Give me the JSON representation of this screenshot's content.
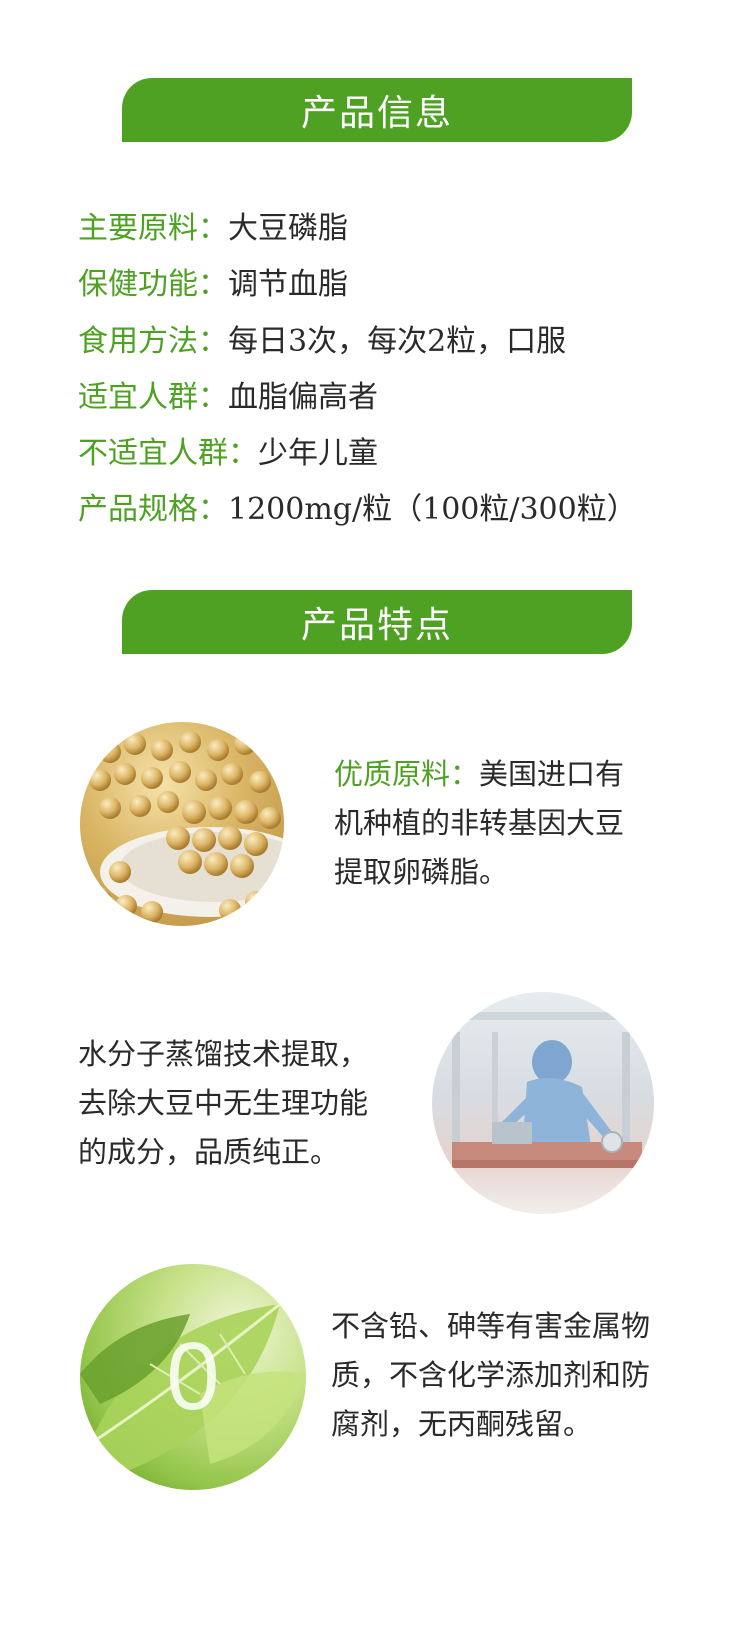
{
  "sections": {
    "info_title": "产品信息",
    "features_title": "产品特点"
  },
  "info": [
    {
      "key": "主要原料：",
      "value": "大豆磷脂"
    },
    {
      "key": "保健功能：",
      "value": "调节血脂"
    },
    {
      "key": "食用方法：",
      "value": "每日3次，每次2粒，口服"
    },
    {
      "key": "适宜人群：",
      "value": "血脂偏高者"
    },
    {
      "key": "不适宜人群：",
      "value": "少年儿童"
    },
    {
      "key": "产品规格：",
      "value": "1200mg/粒（100粒/300粒）"
    }
  ],
  "features": [
    {
      "highlight": "优质原料：",
      "lines": [
        "美国进口有",
        "机种植的非转基因大豆",
        "提取卵磷脂。"
      ],
      "icon": "soybean-image"
    },
    {
      "lines": [
        "水分子蒸馏技术提取，",
        "去除大豆中无生理功能",
        "的成分，品质纯正。"
      ],
      "icon": "lab-worker-image"
    },
    {
      "badge": "0",
      "lines": [
        "不含铅、砷等有害金属物",
        "质，不含化学添加剂和防",
        "腐剂，无丙酮残留。"
      ],
      "icon": "green-leaf-image"
    }
  ],
  "colors": {
    "accent": "#4fa124",
    "text": "#2a2a2a"
  }
}
